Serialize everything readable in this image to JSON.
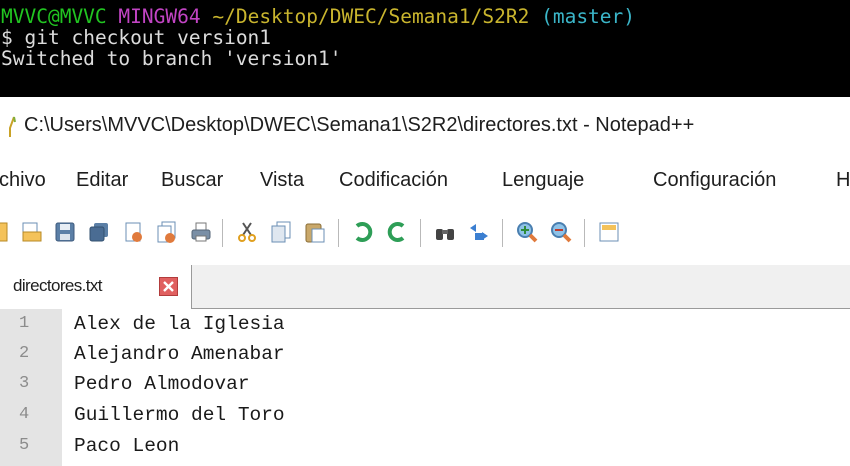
{
  "terminal": {
    "prompt_user": "MVVC@MVVC",
    "prompt_system": "MINGW64",
    "prompt_path": "~/Desktop/DWEC/Semana1/S2R2",
    "prompt_branch": "(master)",
    "prompt_symbol": "$",
    "command": "git checkout version1",
    "output": "Switched to branch 'version1'"
  },
  "window": {
    "title": "C:\\Users\\MVVC\\Desktop\\DWEC\\Semana1\\S2R2\\directores.txt - Notepad++"
  },
  "menu": {
    "items": [
      "chivo",
      "Editar",
      "Buscar",
      "Vista",
      "Codificación",
      "Lenguaje",
      "Configuración",
      "H"
    ]
  },
  "toolbar": {
    "icons": [
      "new-file-icon",
      "open-file-icon",
      "save-icon",
      "save-all-icon",
      "close-icon",
      "close-all-icon",
      "print-icon",
      "cut-icon",
      "copy-icon",
      "paste-icon",
      "undo-icon",
      "redo-icon",
      "find-icon",
      "replace-icon",
      "zoom-in-icon",
      "zoom-out-icon",
      "sync-view-icon"
    ]
  },
  "tab": {
    "label": "directores.txt"
  },
  "editor": {
    "lines": [
      {
        "number": "1",
        "text": "Alex de la Iglesia"
      },
      {
        "number": "2",
        "text": "Alejandro Amenabar"
      },
      {
        "number": "3",
        "text": "Pedro Almodovar"
      },
      {
        "number": "4",
        "text": "Guillermo del Toro"
      },
      {
        "number": "5",
        "text": "Paco Leon"
      }
    ]
  },
  "colors": {
    "terminal_bg": "#000000",
    "prompt_user": "#21c521",
    "prompt_system": "#c244c4",
    "prompt_path": "#c9b52e",
    "prompt_branch": "#3bb6c9",
    "gutter_bg": "#e4e4e4",
    "tab_close": "#e06060"
  }
}
